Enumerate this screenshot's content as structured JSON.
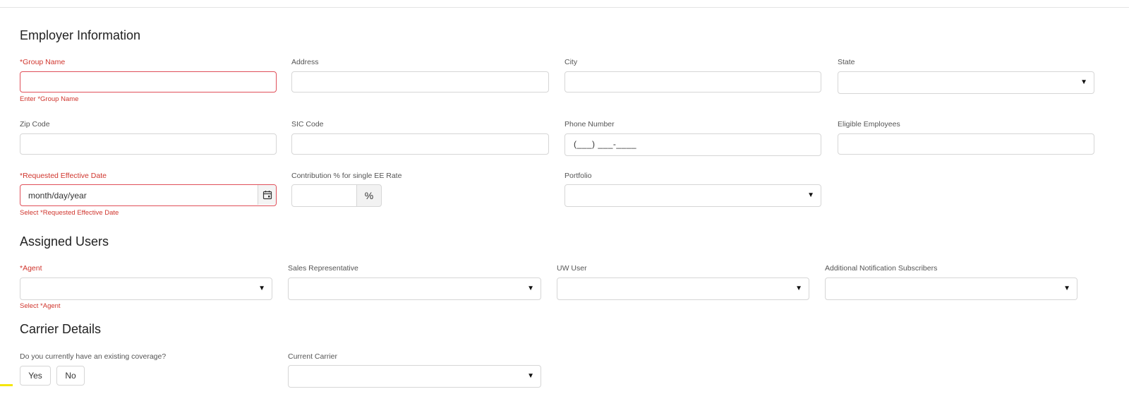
{
  "employer": {
    "title": "Employer Information",
    "group_name": {
      "label": "*Group Name",
      "value": "",
      "error": "Enter *Group Name"
    },
    "address": {
      "label": "Address",
      "value": ""
    },
    "city": {
      "label": "City",
      "value": ""
    },
    "state": {
      "label": "State",
      "selected": ""
    },
    "zip_code": {
      "label": "Zip Code",
      "value": ""
    },
    "sic_code": {
      "label": "SIC Code",
      "value": ""
    },
    "phone_number": {
      "label": "Phone Number",
      "mask": "(___) ___-____"
    },
    "eligible_employees": {
      "label": "Eligible Employees",
      "value": ""
    },
    "effective_date": {
      "label": "*Requested Effective Date",
      "placeholder": "month/day/year",
      "error": "Select *Requested Effective Date"
    },
    "contribution": {
      "label": "Contribution % for single EE Rate",
      "value": "",
      "addon": "%"
    },
    "portfolio": {
      "label": "Portfolio",
      "selected": ""
    }
  },
  "assigned_users": {
    "title": "Assigned Users",
    "agent": {
      "label": "*Agent",
      "selected": "",
      "error": "Select *Agent"
    },
    "sales_rep": {
      "label": "Sales Representative",
      "selected": ""
    },
    "uw_user": {
      "label": "UW User",
      "selected": ""
    },
    "notification": {
      "label": "Additional Notification Subscribers",
      "selected": ""
    }
  },
  "carrier": {
    "title": "Carrier Details",
    "existing_coverage": {
      "label": "Do you currently have an existing coverage?",
      "yes": "Yes",
      "no": "No"
    },
    "current_carrier": {
      "label": "Current Carrier",
      "selected": ""
    }
  },
  "icons": {
    "caret": "▼",
    "calendar": "calendar-icon"
  },
  "colors": {
    "error": "#d0352d",
    "border": "#d6d6d6",
    "error_border": "#e0505a"
  }
}
